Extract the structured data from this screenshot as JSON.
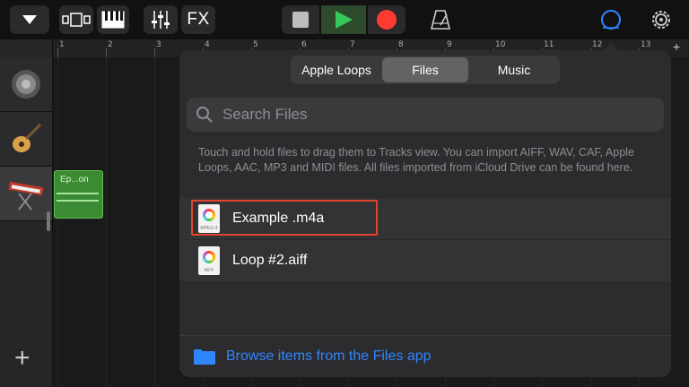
{
  "toolbar": {
    "fx_label": "FX",
    "icons": [
      "tracks-menu-icon",
      "track-view-icon",
      "keyboard-icon",
      "mixer-icon",
      "stop-icon",
      "play-icon",
      "record-icon",
      "metronome-icon",
      "loop-browser-icon",
      "settings-icon"
    ]
  },
  "ruler": {
    "ticks": [
      "1",
      "2",
      "3",
      "4",
      "5",
      "6",
      "7",
      "8",
      "9",
      "10",
      "11",
      "12",
      "13"
    ]
  },
  "tracks": [
    {
      "name": "drummer",
      "icon": "drum-icon"
    },
    {
      "name": "guitar",
      "icon": "guitar-icon"
    },
    {
      "name": "keyboard",
      "icon": "keyboard-instrument-icon"
    }
  ],
  "region": {
    "label": "Ep...on"
  },
  "popover": {
    "tabs": [
      "Apple Loops",
      "Files",
      "Music"
    ],
    "active_tab": "Files",
    "search_placeholder": "Search Files",
    "hint": "Touch and hold files to drag them to Tracks view. You can import AIFF, WAV, CAF, Apple Loops, AAC, MP3 and MIDI files. All files imported from iCloud Drive can be found here.",
    "files": [
      {
        "name": "Example .m4a",
        "ext": "MPEG-4"
      },
      {
        "name": "Loop #2.aiff",
        "ext": "AIFF"
      }
    ],
    "browse_label": "Browse items from the Files app"
  },
  "colors": {
    "accent": "#2f86ff",
    "record": "#ff3b30",
    "play": "#34c759",
    "highlight": "#e0452e",
    "region": "#3b8b34"
  }
}
